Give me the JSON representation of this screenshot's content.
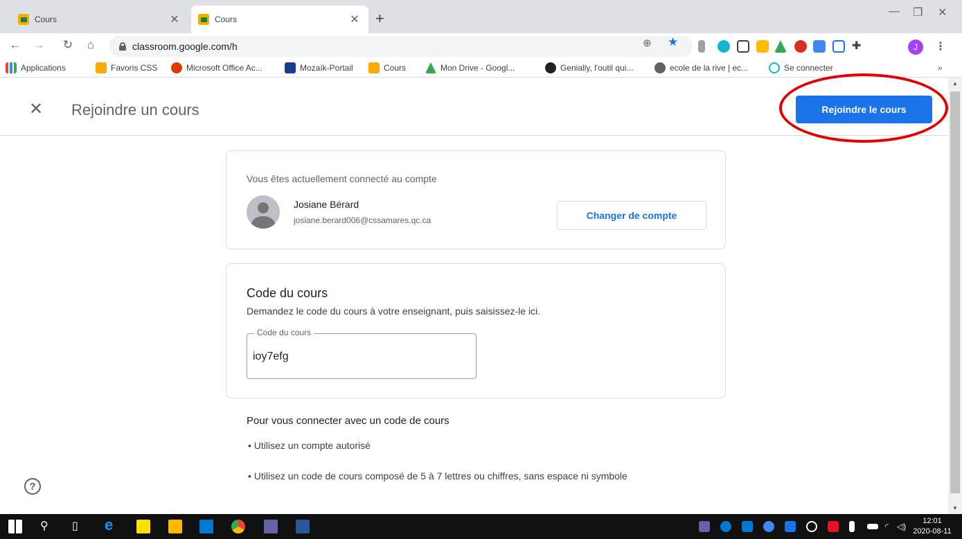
{
  "browser": {
    "tabs": [
      {
        "title": "Cours",
        "active": false
      },
      {
        "title": "Cours",
        "active": true
      }
    ],
    "url": "classroom.google.com/h",
    "profile_initial": "J",
    "bookmarks": [
      "Applications",
      "Favoris CSS",
      "Microsoft Office Ac...",
      "Mozaïk-Portail",
      "Cours",
      "Mon Drive - Googl...",
      "Genially, l'outil qui...",
      "ecole de la rive | ec...",
      "Se connecter"
    ],
    "bookmarks_more": "»"
  },
  "page": {
    "title": "Rejoindre un cours",
    "join_button": "Rejoindre le cours",
    "account": {
      "intro": "Vous êtes actuellement connecté au compte",
      "name": "Josiane Bérard",
      "email": "josiane.berard006@cssamares.qc.ca",
      "switch_button": "Changer de compte"
    },
    "course_code": {
      "title": "Code du cours",
      "hint": "Demandez le code du cours à votre enseignant, puis saisissez-le ici.",
      "field_label": "Code du cours",
      "value": "ioy7efg"
    },
    "rules": {
      "title": "Pour vous connecter avec un code de cours",
      "items": [
        "Utilisez un compte autorisé",
        "Utilisez un code de cours composé de 5 à 7 lettres ou chiffres, sans espace ni symbole"
      ]
    },
    "help_icon": "?"
  },
  "taskbar": {
    "time": "12:01",
    "date": "2020-08-11"
  },
  "colors": {
    "accent": "#1a73e8",
    "annotation": "#e00000"
  }
}
